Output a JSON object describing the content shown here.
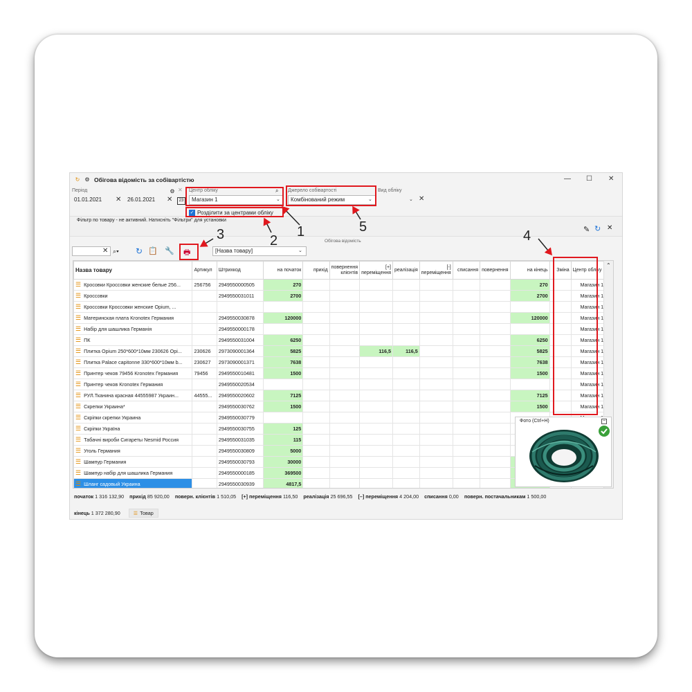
{
  "window": {
    "title": "Обігова відомість за собівартістю",
    "controls": [
      "—",
      "☐",
      "✕"
    ]
  },
  "filters": {
    "period_label": "Період",
    "date_from": "01.01.2021",
    "date_to": "26.01.2021",
    "calendar_label": "23",
    "center_label": "Центр обліку",
    "center_value": "Магазин 1",
    "split_label": "Розділити за центрами обліку",
    "source_label": "Джерело собівартості",
    "source_value": "Комбінований режим",
    "view_label": "Вид обліку",
    "view_value": "",
    "filter_message": "Фільтр по товару - не активний. Натисніть \"Фільтри\" для установки",
    "panel_title": "Обігова відомість"
  },
  "toolbar": {
    "search_value": "",
    "group_select": "[Назва товару]"
  },
  "table": {
    "columns": [
      "Назва товару",
      "Артикул",
      "Штрихкод",
      "на початок",
      "прихід",
      "повернення клієнтів",
      "[+] переміщення",
      "реалізація",
      "[-] переміщення",
      "списання",
      "повернення",
      "на кінець",
      "Зміна",
      "Центр обліку"
    ],
    "rows": [
      {
        "name": "Кросовки Кроссовки женские белые 256...",
        "art": "256756",
        "bar": "2949550000505",
        "start": "270",
        "move_in": "",
        "sale": "",
        "end": "270",
        "center": "Магазин 1"
      },
      {
        "name": "Кроссовки",
        "art": "",
        "bar": "2949550031011",
        "start": "2700",
        "move_in": "",
        "sale": "",
        "end": "2700",
        "center": "Магазин 1"
      },
      {
        "name": "Кроссовки Кроссовки женские Оріum, ...",
        "art": "",
        "bar": "",
        "start": "",
        "move_in": "",
        "sale": "",
        "end": "",
        "center": "Магазин 1"
      },
      {
        "name": "Материнская плата Kronotex Германия",
        "art": "",
        "bar": "2949550030878",
        "start": "120000",
        "move_in": "",
        "sale": "",
        "end": "120000",
        "center": "Магазин 1"
      },
      {
        "name": "Набір для шашлика Германія",
        "art": "",
        "bar": "2949550000178",
        "start": "",
        "move_in": "",
        "sale": "",
        "end": "",
        "center": "Магазин 1"
      },
      {
        "name": "ПК",
        "art": "",
        "bar": "2949550031004",
        "start": "6250",
        "move_in": "",
        "sale": "",
        "end": "6250",
        "center": "Магазин 1"
      },
      {
        "name": "Плитка Opium 250*600*10мм 230626 Орі...",
        "art": "230626",
        "bar": "2973090001364",
        "start": "5825",
        "move_in": "116,5",
        "sale": "116,5",
        "end": "5825",
        "center": "Магазин 1"
      },
      {
        "name": "Плитка Palace capitonne 330*600*10мм b...",
        "art": "230627",
        "bar": "2973090001371",
        "start": "7638",
        "move_in": "",
        "sale": "",
        "end": "7638",
        "center": "Магазин 1"
      },
      {
        "name": "Принтер чеков 79456 Kronotex Германия",
        "art": "79456",
        "bar": "2949550010481",
        "start": "1500",
        "move_in": "",
        "sale": "",
        "end": "1500",
        "center": "Магазин 1"
      },
      {
        "name": "Принтер чеков Kronotex Германия",
        "art": "",
        "bar": "2949550020534",
        "start": "",
        "move_in": "",
        "sale": "",
        "end": "",
        "center": "Магазин 1"
      },
      {
        "name": "РУЛ.Тканина красная 44555987 Украин...",
        "art": "44555...",
        "bar": "2949550020602",
        "start": "7125",
        "move_in": "",
        "sale": "",
        "end": "7125",
        "center": "Магазин 1"
      },
      {
        "name": "Скрепки Украина*",
        "art": "",
        "bar": "2949550030762",
        "start": "1500",
        "move_in": "",
        "sale": "",
        "end": "1500",
        "center": "Магазин 1"
      },
      {
        "name": "Скріпки скрепки Украина",
        "art": "",
        "bar": "2949550030779",
        "start": "",
        "move_in": "",
        "sale": "",
        "end": "",
        "center": "Магазин 1"
      },
      {
        "name": "Скріпки Україна",
        "art": "",
        "bar": "2949550030755",
        "start": "125",
        "move_in": "",
        "sale": "",
        "end": "",
        "center": ""
      },
      {
        "name": "Табачні вироби Сигареты Nesmid Россия",
        "art": "",
        "bar": "2949550031035",
        "start": "115",
        "move_in": "",
        "sale": "",
        "end": "",
        "center": ""
      },
      {
        "name": "Уголь Германия",
        "art": "",
        "bar": "2949550030809",
        "start": "5000",
        "move_in": "",
        "sale": "",
        "end": "",
        "center": ""
      },
      {
        "name": "Шампур Германия",
        "art": "",
        "bar": "2949550030793",
        "start": "30000",
        "move_in": "",
        "sale": "",
        "end": "3",
        "center": ""
      },
      {
        "name": "Шампур набір для шашлика Германия",
        "art": "",
        "bar": "2949550000185",
        "start": "369500",
        "move_in": "",
        "sale": "",
        "end": "36",
        "center": ""
      },
      {
        "name": "Шланг садовый Украина",
        "art": "",
        "bar": "2949550030939",
        "start": "4817,5",
        "move_in": "",
        "sale": "",
        "end": "48",
        "center": "",
        "selected": true
      }
    ]
  },
  "status": {
    "line1": [
      {
        "k": "початок",
        "v": "1 316 132,90"
      },
      {
        "k": "прихід",
        "v": "85 920,00"
      },
      {
        "k": "поверн. клієнтів",
        "v": "1 510,05"
      },
      {
        "k": "[+] переміщення",
        "v": "116,50"
      },
      {
        "k": "реалізація",
        "v": "25 696,55"
      },
      {
        "k": "[–] переміщення",
        "v": "4 204,00"
      },
      {
        "k": "списання",
        "v": "0,00"
      },
      {
        "k": "поверн. постачальникам",
        "v": "1 500,00"
      }
    ],
    "line2_key": "кінець",
    "line2_val": "1 372 280,90",
    "tab_label": "Товар"
  },
  "photo": {
    "title": "Фото (Ctrl+H)"
  },
  "annotations": [
    "1",
    "2",
    "3",
    "4",
    "5"
  ],
  "colors": {
    "highlight": "#e0181e",
    "green_cell": "#c8f5c0",
    "selection": "#2d8fe6",
    "accent": "#e08a00"
  }
}
